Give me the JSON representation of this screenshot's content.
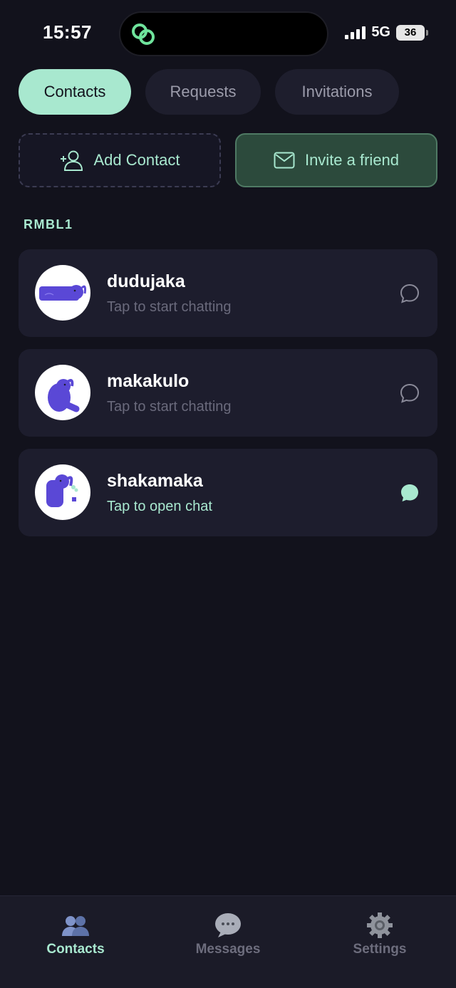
{
  "status_bar": {
    "time": "15:57",
    "network": "5G",
    "battery": "36"
  },
  "tabs": [
    {
      "label": "Contacts",
      "active": true
    },
    {
      "label": "Requests",
      "active": false
    },
    {
      "label": "Invitations",
      "active": false
    }
  ],
  "actions": {
    "add_contact": "Add Contact",
    "invite": "Invite a friend"
  },
  "section": {
    "label": "RMBL1"
  },
  "contacts": [
    {
      "name": "dudujaka",
      "subtitle": "Tap to start chatting",
      "chat_icon": "chat-bubble-outline-icon"
    },
    {
      "name": "makakulo",
      "subtitle": "Tap to start chatting",
      "chat_icon": "chat-bubble-outline-icon"
    },
    {
      "name": "shakamaka",
      "subtitle": "Tap to open chat",
      "chat_icon": "chat-bubble-filled-icon"
    }
  ],
  "bottom_nav": {
    "contacts": "Contacts",
    "messages": "Messages",
    "settings": "Settings"
  },
  "colors": {
    "background": "#12121c",
    "accent": "#a8e8cf",
    "card": "#1d1d2d",
    "avatar_purple": "#5a48d6"
  }
}
